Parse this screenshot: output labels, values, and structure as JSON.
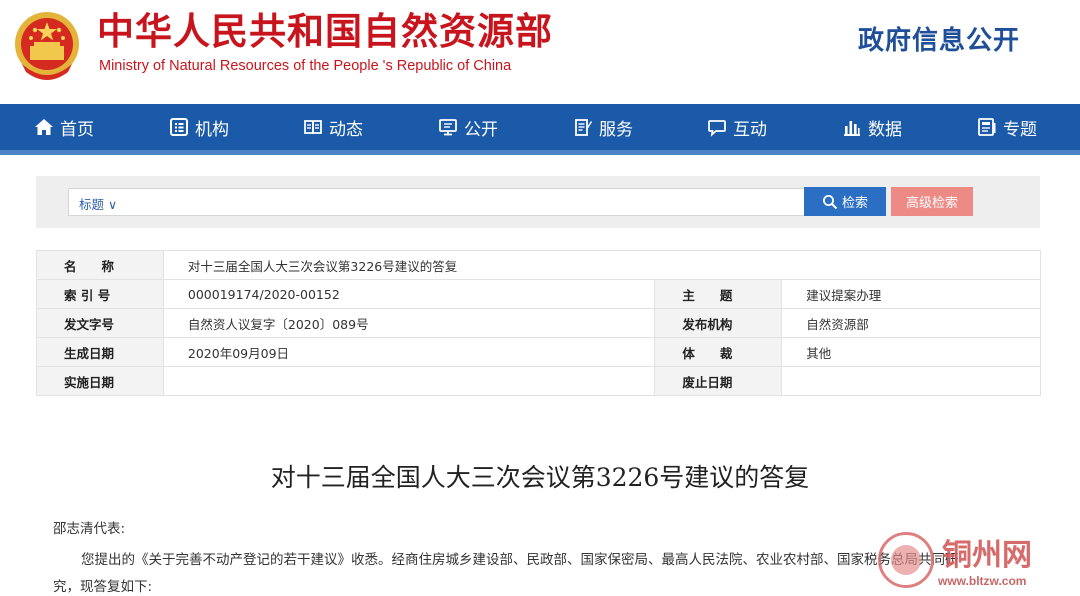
{
  "header": {
    "title": "中华人民共和国自然资源部",
    "subtitle": "Ministry of Natural Resources of the People 's Republic of China",
    "gov_open": "政府信息公开"
  },
  "nav": {
    "items": [
      {
        "label": "首页",
        "icon": "home-icon"
      },
      {
        "label": "机构",
        "icon": "org-icon"
      },
      {
        "label": "动态",
        "icon": "book-icon"
      },
      {
        "label": "公开",
        "icon": "monitor-icon"
      },
      {
        "label": "服务",
        "icon": "document-icon"
      },
      {
        "label": "互动",
        "icon": "chat-icon"
      },
      {
        "label": "数据",
        "icon": "bar-chart-icon"
      },
      {
        "label": "专题",
        "icon": "topic-icon"
      }
    ]
  },
  "search": {
    "field_select": "标题 ∨",
    "search_button": "检索",
    "advanced_button": "高级检索"
  },
  "info": {
    "name_label": "名　　称",
    "name_value": "对十三届全国人大三次会议第3226号建议的答复",
    "index_label": "索 引 号",
    "index_value": "000019174/2020-00152",
    "subject_label": "主　　题",
    "subject_value": "建议提案办理",
    "docno_label": "发文字号",
    "docno_value": "自然资人议复字〔2020〕089号",
    "issuer_label": "发布机构",
    "issuer_value": "自然资源部",
    "date_label": "生成日期",
    "date_value": "2020年09月09日",
    "genre_label": "体　　裁",
    "genre_value": "其他",
    "effective_label": "实施日期",
    "effective_value": "",
    "abolish_label": "废止日期",
    "abolish_value": ""
  },
  "article": {
    "title": "对十三届全国人大三次会议第3226号建议的答复",
    "salutation": "邵志清代表:",
    "para1": "您提出的《关于完善不动产登记的若干建议》收悉。经商住房城乡建设部、民政部、国家保密局、最高人民法院、农业农村部、国家税务总局共同研",
    "para1_cont": "究，现答复如下:"
  },
  "watermark": {
    "text": "铜州网",
    "url": "www.bltzw.com"
  },
  "colors": {
    "brand_red": "#c8151d",
    "nav_blue": "#1a5aa8",
    "gov_blue": "#1f4f99",
    "search_blue": "#2a6fc4",
    "advanced_pink": "#ee8a86"
  }
}
